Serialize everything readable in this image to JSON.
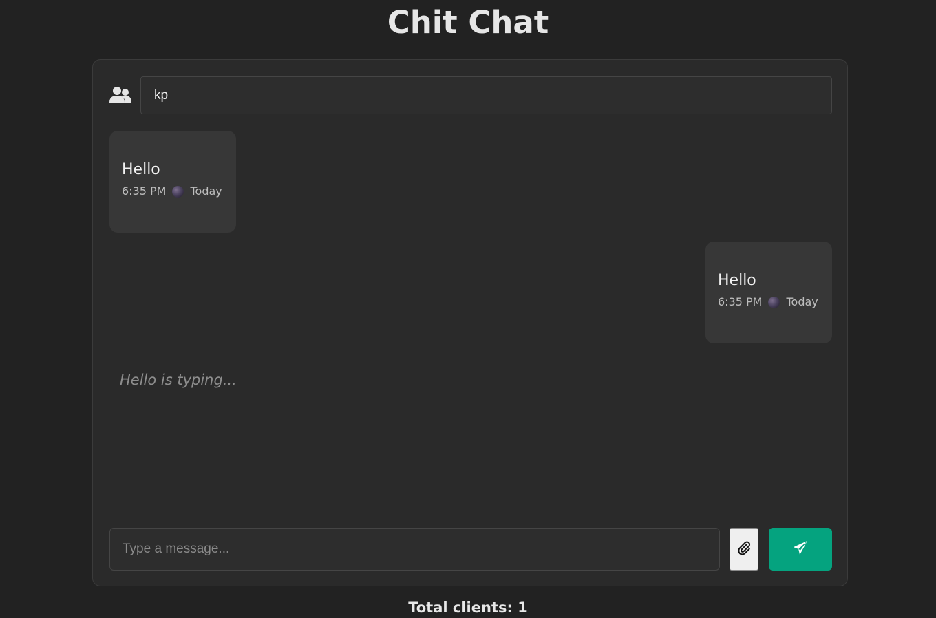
{
  "app": {
    "title": "Chit Chat"
  },
  "header": {
    "users_icon": "users-icon",
    "name_value": "kp"
  },
  "messages": [
    {
      "direction": "incoming",
      "text": "Hello",
      "time": "6:35 PM",
      "day": "Today",
      "status_icon": "moon-icon"
    },
    {
      "direction": "outgoing",
      "text": "Hello",
      "time": "6:35 PM",
      "day": "Today",
      "status_icon": "moon-icon"
    }
  ],
  "typing_indicator": "Hello is typing...",
  "composer": {
    "placeholder": "Type a message...",
    "value": "",
    "attach_icon": "paperclip-icon",
    "send_icon": "paper-plane-icon"
  },
  "footer": {
    "total_clients": "Total clients: 1"
  },
  "colors": {
    "background": "#222222",
    "panel": "#2a2a2a",
    "bubble": "#373737",
    "accent": "#05a37f"
  }
}
